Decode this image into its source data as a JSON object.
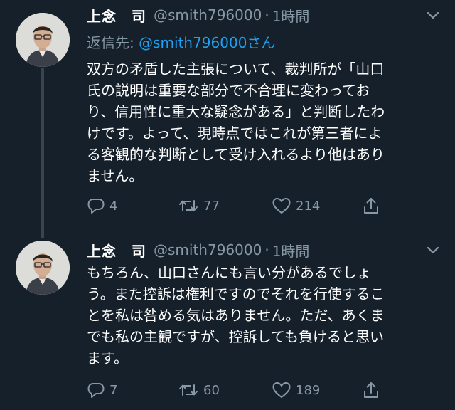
{
  "tweets": [
    {
      "name": "上念　司",
      "handle": "@smith796000",
      "separator": "·",
      "time": "1時間",
      "reply_to_prefix": "返信先: ",
      "reply_to_handle": "@smith796000さん",
      "text": "双方の矛盾した主張について、裁判所が「山口\n氏の説明は重要な部分で不合理に変わってお\nり、信用性に重大な疑念がある」と判断したわ\nけです。よって、現時点ではこれが第三者によ\nる客観的な判断として受け入れるより他はあり\nません。",
      "replies": "4",
      "retweets": "77",
      "likes": "214"
    },
    {
      "name": "上念　司",
      "handle": "@smith796000",
      "separator": "·",
      "time": "1時間",
      "text": "もちろん、山口さんにも言い分があるでしょ\nう。また控訴は権利ですのでそれを行使するこ\nとを私は咎める気はありません。ただ、あくま\nでも私の主観ですが、控訴しても負けると思い\nます。",
      "replies": "7",
      "retweets": "60",
      "likes": "189"
    }
  ],
  "icons": {
    "menu": "chevron-down-icon",
    "reply": "reply-icon",
    "retweet": "retweet-icon",
    "like": "heart-icon",
    "share": "share-icon"
  },
  "colors": {
    "background": "#15202b",
    "secondary_text": "#8899a6",
    "link": "#1da1f2",
    "thread_line": "#3a444c"
  }
}
